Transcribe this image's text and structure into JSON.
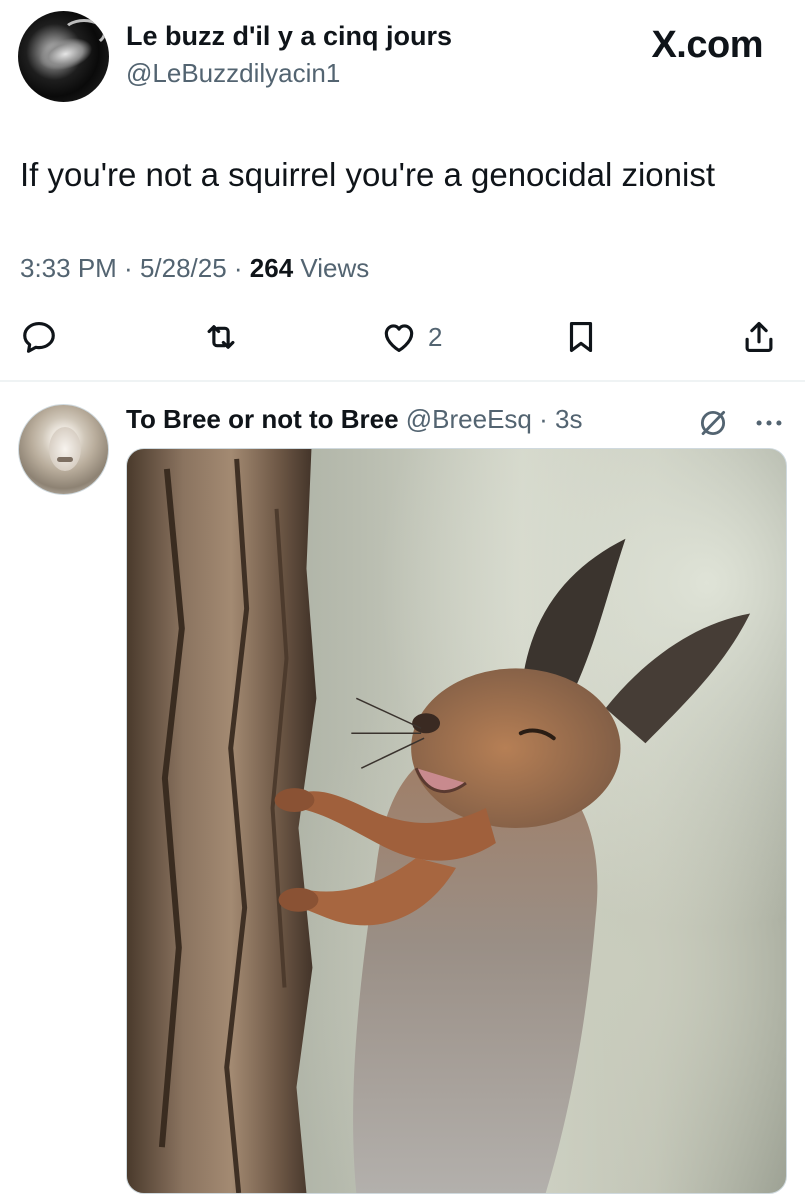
{
  "main_tweet": {
    "author_name": "Le buzz d'il y a cinq jours",
    "author_handle": "@LeBuzzdilyacin1",
    "brand": "X.com",
    "text": "If you're not a squirrel you're a genocidal zionist",
    "time": "3:33 PM",
    "date": "5/28/25",
    "separator": " · ",
    "views_count": "264",
    "views_label": " Views",
    "actions": {
      "reply_icon": "reply-icon",
      "retweet_icon": "retweet-icon",
      "like_icon": "heart-icon",
      "like_count": "2",
      "bookmark_icon": "bookmark-icon",
      "share_icon": "share-icon"
    }
  },
  "reply": {
    "author_name": "To Bree or not to Bree",
    "author_handle": "@BreeEsq",
    "separator": " · ",
    "time": "3s",
    "grok_icon": "grok-icon",
    "more_icon": "more-icon",
    "image_content": "squirrel-photo"
  }
}
